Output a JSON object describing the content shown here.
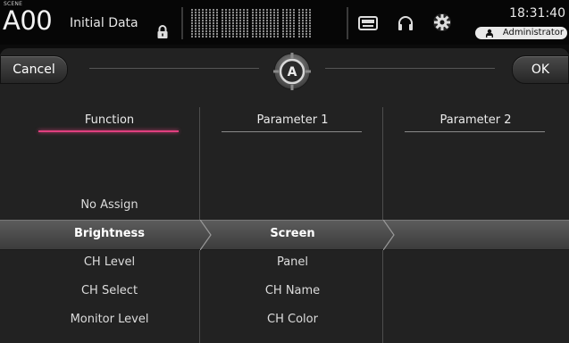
{
  "status_bar": {
    "scene_label": "SCENE",
    "scene_number": "A00",
    "scene_title": "Initial Data",
    "time": "18:31:40",
    "user": "Administrator"
  },
  "dialog": {
    "cancel_label": "Cancel",
    "ok_label": "OK",
    "badge_letter": "A"
  },
  "columns": {
    "function": {
      "header": "Function",
      "items": [
        "No Assign",
        "Brightness",
        "CH Level",
        "CH Select",
        "Monitor Level"
      ],
      "selected": "Brightness"
    },
    "parameter1": {
      "header": "Parameter 1",
      "items": [
        "Screen",
        "Panel",
        "CH Name",
        "CH Color"
      ],
      "selected": "Screen"
    },
    "parameter2": {
      "header": "Parameter 2",
      "items": []
    }
  },
  "colors": {
    "active_underline": "#e0407f",
    "background": "#222222"
  }
}
